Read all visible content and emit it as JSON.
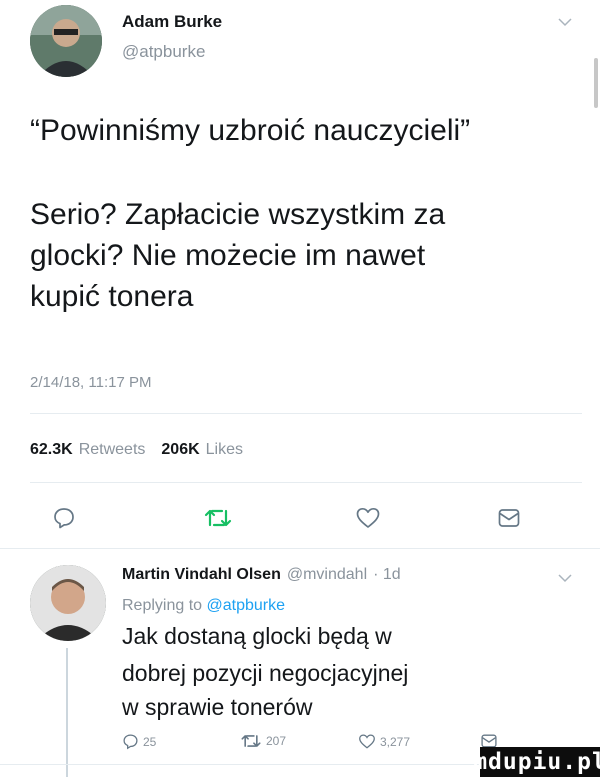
{
  "tweet": {
    "author_name": "Adam Burke",
    "author_handle": "@atpburke",
    "text_line1": "“Powinniśmy uzbroić nauczycieli”",
    "text_line2": "Serio? Zapłacicie wszystkim za",
    "text_line3": "glocki? Nie możecie im nawet",
    "text_line4": "kupić tonera",
    "timestamp": "2/14/18, 11:17 PM",
    "retweets_count": "62.3K",
    "retweets_label": "Retweets",
    "likes_count": "206K",
    "likes_label": "Likes",
    "retweet_color": "#17bf63"
  },
  "reply": {
    "author_name": "Martin Vindahl Olsen",
    "author_handle": "@mvindahl",
    "time_ago": "· 1d",
    "replying_prefix": "Replying to",
    "replying_to": "@atpburke",
    "text_line1": "Jak dostaną glocki będą w",
    "text_line2": "dobrej pozycji negocjacyjnej",
    "text_line3": "w sprawie tonerów",
    "reply_count": "25",
    "retweet_count": "207",
    "like_count": "3,277"
  },
  "watermark": {
    "text": "mdupiu.pl"
  },
  "icons": [
    "reply-icon",
    "retweet-icon",
    "like-icon",
    "message-icon",
    "chevron-down-icon"
  ]
}
